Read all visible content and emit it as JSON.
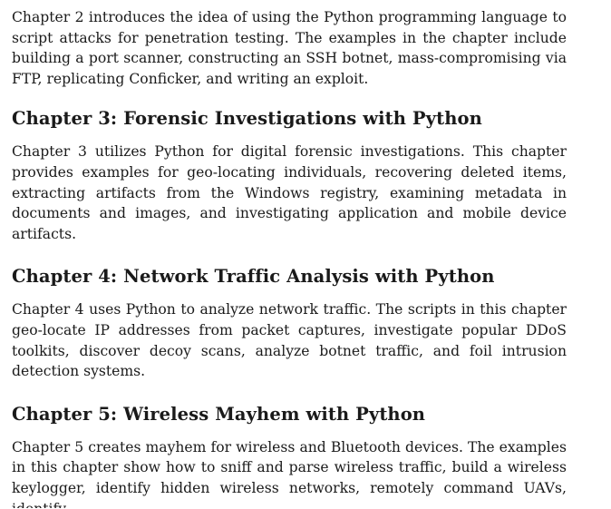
{
  "intro": {
    "text": "Chapter 2 introduces the idea of using the Python programming language to script attacks for penetration testing. The examples in the chapter include building a port scanner, constructing an SSH botnet, mass-compromising via FTP, replicating Conficker, and writing an exploit."
  },
  "sections": [
    {
      "heading": "Chapter 3: Forensic Investigations with Python",
      "text": "Chapter 3 utilizes Python for digital forensic investigations. This chapter pro­vides examples for geo-locating individuals, recovering deleted items, extract­ing artifacts from the Windows registry, examining metadata in documents and images, and investigating application and mobile device artifacts."
    },
    {
      "heading": "Chapter 4: Network Traffic Analysis with Python",
      "text": "Chapter 4 uses Python to analyze network traffic. The scripts in this chapter geo-locate IP addresses from packet captures, investigate popular DDoS tool­kits, discover decoy scans, analyze botnet traffic, and foil intrusion detection systems."
    },
    {
      "heading": "Chapter 5: Wireless Mayhem with Python",
      "text": "Chapter 5 creates mayhem for wireless and Bluetooth devices. The examples in this chapter show how to sniff and parse wireless traffic, build a wireless key­logger, identify hidden wireless networks, remotely command UAVs, identify"
    }
  ]
}
